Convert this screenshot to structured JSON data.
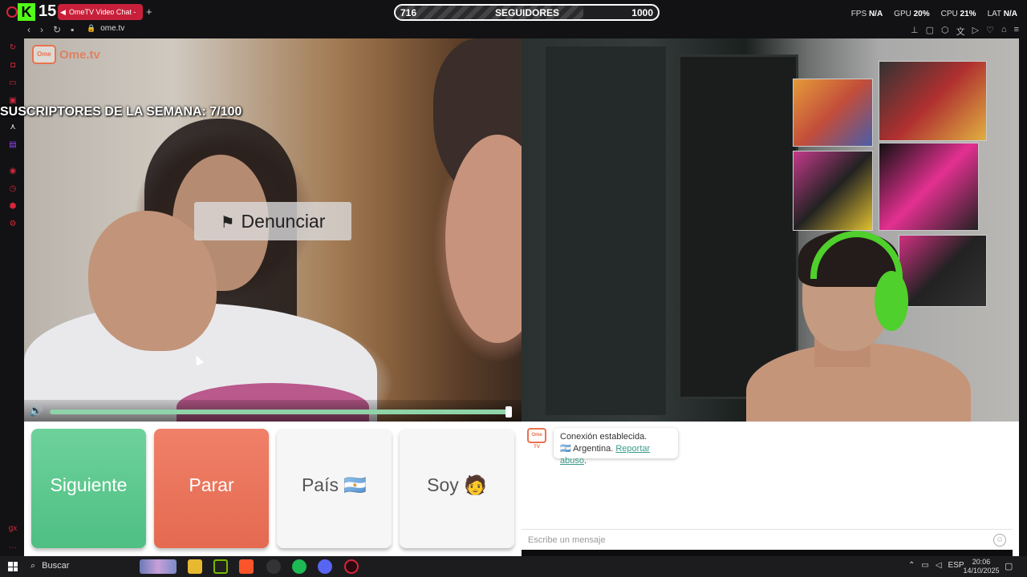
{
  "browser": {
    "kick_logo": "K",
    "kick_number": "15",
    "tab_title": "OmeTV Video Chat -",
    "new_tab": "+",
    "url": "ome.tv"
  },
  "followers": {
    "current": "716",
    "label": "SEGUIDORES",
    "goal": "1000",
    "progress_fraction": 0.716
  },
  "stats": {
    "fps_label": "FPS",
    "fps_value": "N/A",
    "gpu_label": "GPU",
    "gpu_value": "20%",
    "cpu_label": "CPU",
    "cpu_value": "21%",
    "lat_label": "LAT",
    "lat_value": "N/A"
  },
  "overlay": {
    "subs_text": "SUSCRIPTORES DE LA SEMANA: 7/100"
  },
  "video": {
    "logo_box": "Ome",
    "logo_text": "Ome.tv",
    "report_label": "Denunciar",
    "volume_fraction": 1.0
  },
  "controls": {
    "next_label": "Siguiente",
    "stop_label": "Parar",
    "country_label": "País 🇦🇷",
    "me_label": "Soy 🧑"
  },
  "chat": {
    "logo": "Ome TV",
    "status": "Conexión establecida.",
    "country": "🇦🇷 Argentina.",
    "report_link": "Reportar abuso",
    "period": ".",
    "placeholder": "Escribe un mensaje"
  },
  "taskbar": {
    "search_label": "Buscar",
    "lang": "ESP",
    "time": "20:06",
    "date": "14/10/2025"
  },
  "colors": {
    "accent": "#d6263a",
    "next_green": "#5cc88e",
    "stop_red": "#e97558",
    "kick_green": "#53fc18"
  }
}
